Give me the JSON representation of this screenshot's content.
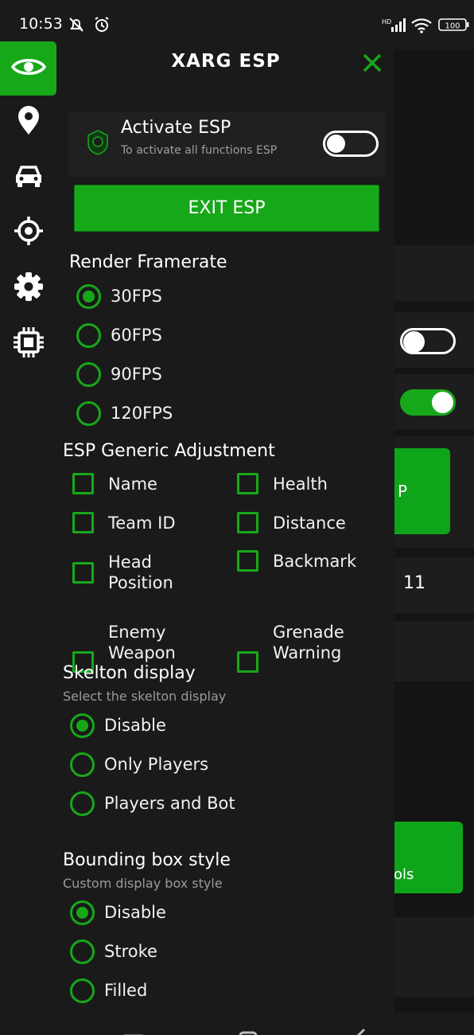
{
  "status_bar": {
    "time": "10:53",
    "battery": "100",
    "network": "HD"
  },
  "background_app": {
    "partial_button_text": "P",
    "partial_value": "11",
    "partial_tools_text": "ols"
  },
  "side_nav": {
    "items": [
      {
        "icon": "eye-icon",
        "active": true
      },
      {
        "icon": "location-pin-icon",
        "active": false
      },
      {
        "icon": "car-icon",
        "active": false
      },
      {
        "icon": "crosshair-icon",
        "active": false
      },
      {
        "icon": "gear-icon",
        "active": false
      },
      {
        "icon": "chip-icon",
        "active": false
      }
    ]
  },
  "panel": {
    "title": "XARG ESP",
    "activate": {
      "title": "Activate ESP",
      "subtitle": "To activate all functions ESP",
      "enabled": false
    },
    "exit_label": "EXIT ESP",
    "render_framerate": {
      "title": "Render Framerate",
      "options": [
        "30FPS",
        "60FPS",
        "90FPS",
        "120FPS"
      ],
      "selected": "30FPS"
    },
    "generic_adjustment": {
      "title": "ESP Generic Adjustment",
      "options": [
        {
          "label": "Name",
          "checked": false
        },
        {
          "label": "Health",
          "checked": false
        },
        {
          "label": "Team ID",
          "checked": false
        },
        {
          "label": "Distance",
          "checked": false
        },
        {
          "label": "Head Position",
          "checked": false
        },
        {
          "label": "Backmark",
          "checked": false
        },
        {
          "label": "Enemy Weapon",
          "checked": false
        },
        {
          "label": "Grenade Warning",
          "checked": false
        }
      ]
    },
    "skeleton_display": {
      "title": "Skelton display",
      "subtitle": "Select the skelton display",
      "options": [
        "Disable",
        "Only Players",
        "Players and Bot"
      ],
      "selected": "Disable"
    },
    "bounding_box": {
      "title": "Bounding box style",
      "subtitle": "Custom display box style",
      "options": [
        "Disable",
        "Stroke",
        "Filled"
      ],
      "selected": "Disable"
    }
  },
  "colors": {
    "accent": "#17a81a",
    "background": "#1a1a1a",
    "card": "#202020"
  }
}
